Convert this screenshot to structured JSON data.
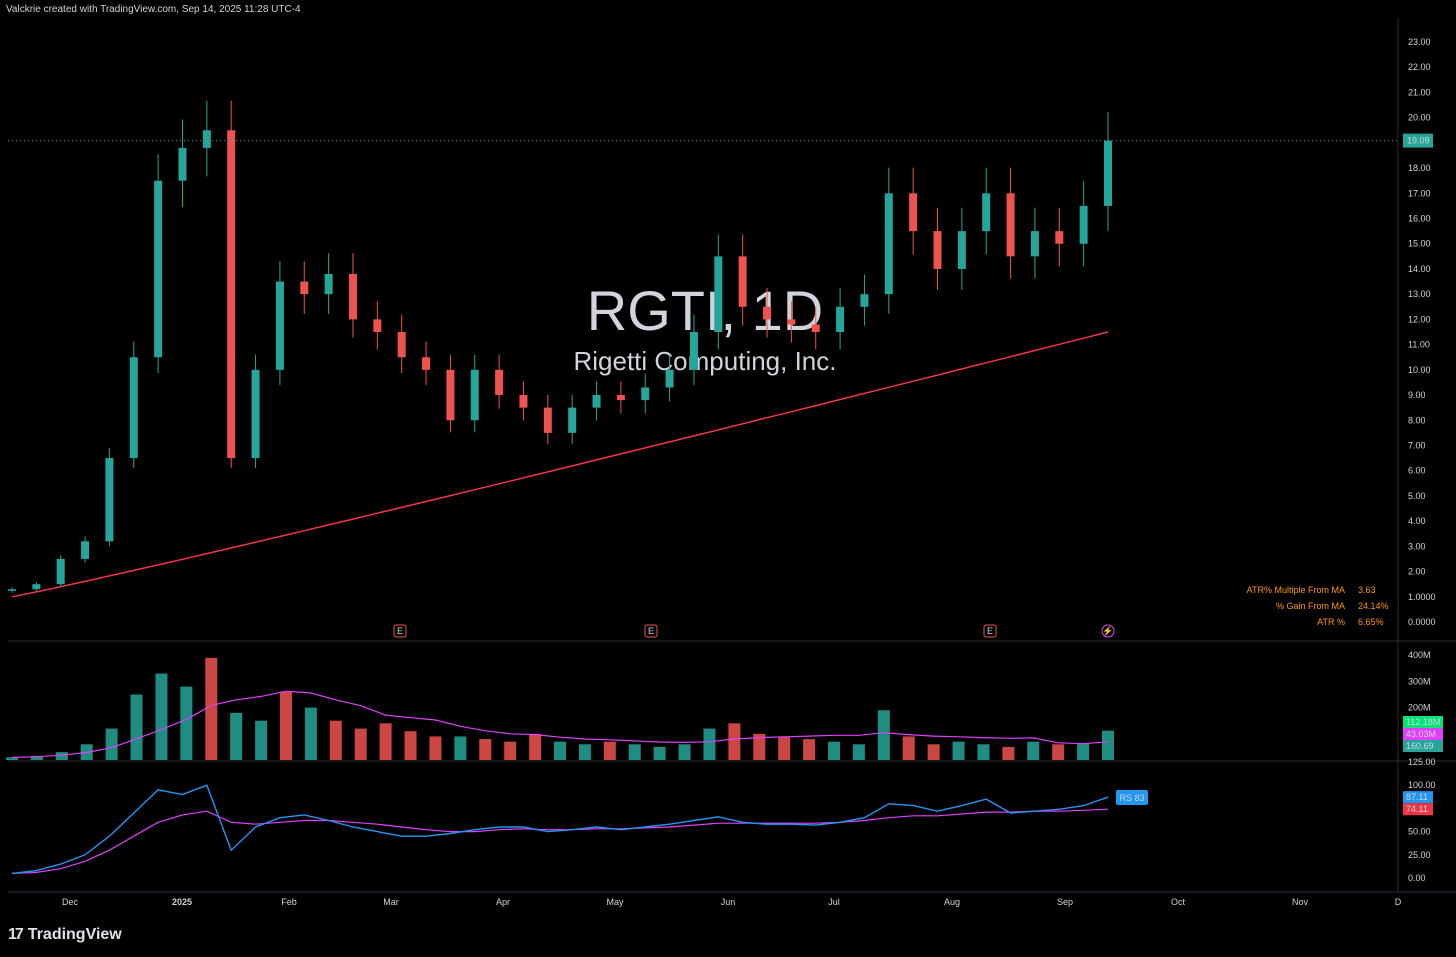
{
  "header": {
    "attribution": "Valckrie created with TradingView.com, Sep 14, 2025 11:28 UTC-4"
  },
  "brand": {
    "logo_glyph": "17",
    "name": "TradingView"
  },
  "watermark": {
    "symbol": "RGTI, 1D",
    "company": "Rigetti Computing, Inc."
  },
  "colors": {
    "up": "#26a69a",
    "down": "#ef5350",
    "bright_up": "#00e676",
    "ma200": "#f23645",
    "volume_ma": "#e040fb",
    "rs_line": "#2196f3",
    "rs_ma": "#f23645"
  },
  "chart_data": [
    {
      "type": "line",
      "name_hint": "price",
      "x": [
        "2024-11-18",
        "2024-11-25",
        "2024-12-02",
        "2024-12-09",
        "2024-12-16",
        "2024-12-23",
        "2024-12-27",
        "2025-01-02",
        "2025-01-06",
        "2025-01-08",
        "2025-01-13",
        "2025-01-21",
        "2025-01-27",
        "2025-02-03",
        "2025-02-10",
        "2025-02-18",
        "2025-02-24",
        "2025-03-03",
        "2025-03-10",
        "2025-03-17",
        "2025-03-24",
        "2025-03-31",
        "2025-04-07",
        "2025-04-14",
        "2025-04-21",
        "2025-04-28",
        "2025-05-05",
        "2025-05-12",
        "2025-05-19",
        "2025-05-27",
        "2025-06-02",
        "2025-06-09",
        "2025-06-16",
        "2025-06-23",
        "2025-06-30",
        "2025-07-07",
        "2025-07-14",
        "2025-07-21",
        "2025-07-28",
        "2025-08-04",
        "2025-08-11",
        "2025-08-18",
        "2025-08-25",
        "2025-09-02",
        "2025-09-08",
        "2025-09-12"
      ],
      "close": [
        1.3,
        1.5,
        2.5,
        3.2,
        6.5,
        10.5,
        17.5,
        18.8,
        19.5,
        6.5,
        10.0,
        13.5,
        13.0,
        13.8,
        12.0,
        11.5,
        10.5,
        10.0,
        8.0,
        10.0,
        9.0,
        8.5,
        7.5,
        8.5,
        9.0,
        8.8,
        9.3,
        10.0,
        11.5,
        14.5,
        12.5,
        12.0,
        11.8,
        11.5,
        12.5,
        13.0,
        17.0,
        15.5,
        14.0,
        15.5,
        17.0,
        14.5,
        15.5,
        15.0,
        16.5,
        19.09
      ],
      "ylim": [
        0,
        23
      ],
      "y_ticks": [
        "23.00",
        "22.00",
        "21.00",
        "20.00",
        "19.00",
        "18.00",
        "17.00",
        "16.00",
        "15.00",
        "14.00",
        "13.00",
        "12.00",
        "11.00",
        "10.00",
        "9.00",
        "8.00",
        "7.00",
        "6.00",
        "5.00",
        "4.00",
        "3.00",
        "2.00",
        "1.0000",
        "0.0000"
      ],
      "last_price_label": "19.09"
    },
    {
      "type": "bar",
      "name_hint": "volume",
      "y_ticks": [
        "400M",
        "300M",
        "200M",
        "100M"
      ],
      "labels": [
        "112.18M",
        "43.03M",
        "160.69"
      ],
      "values_M": [
        10,
        15,
        30,
        60,
        120,
        250,
        330,
        280,
        390,
        180,
        150,
        260,
        200,
        150,
        120,
        140,
        110,
        90,
        90,
        80,
        70,
        100,
        70,
        60,
        70,
        60,
        50,
        60,
        120,
        140,
        100,
        90,
        80,
        70,
        60,
        190,
        90,
        60,
        70,
        60,
        50,
        70,
        60,
        65,
        112
      ]
    },
    {
      "type": "line",
      "name_hint": "relative_strength",
      "y_ticks": [
        "125.00",
        "100.00",
        "75.00",
        "50.00",
        "25.00",
        "0.00"
      ],
      "ylim": [
        0,
        125
      ],
      "rs": [
        5,
        8,
        15,
        25,
        45,
        70,
        95,
        90,
        100,
        30,
        55,
        65,
        68,
        62,
        55,
        50,
        45,
        45,
        48,
        52,
        55,
        55,
        50,
        52,
        55,
        52,
        55,
        58,
        62,
        66,
        60,
        58,
        58,
        57,
        60,
        65,
        80,
        78,
        72,
        78,
        85,
        70,
        72,
        74,
        78,
        87.11
      ],
      "rs_ma": [
        5,
        6,
        10,
        18,
        30,
        45,
        60,
        68,
        72,
        60,
        58,
        60,
        62,
        62,
        60,
        58,
        55,
        52,
        50,
        50,
        52,
        53,
        52,
        52,
        53,
        53,
        54,
        55,
        57,
        59,
        59,
        59,
        59,
        59,
        60,
        62,
        65,
        67,
        67,
        69,
        71,
        71,
        72,
        72,
        73,
        74.11
      ],
      "labels": [
        "87.11",
        "74.11"
      ],
      "badge": "RS 83"
    }
  ],
  "stats": [
    {
      "label": "ATR% Multiple From MA",
      "value": "3.63"
    },
    {
      "label": "% Gain From MA",
      "value": "24.14%"
    },
    {
      "label": "ATR %",
      "value": "6.65%"
    }
  ],
  "x_axis": {
    "labels": [
      "Dec",
      "2025",
      "Feb",
      "Mar",
      "Apr",
      "May",
      "Jun",
      "Jul",
      "Aug",
      "Sep",
      "Oct",
      "Nov",
      "D"
    ]
  },
  "earnings_icon": "E",
  "dividend_icon": "⚡"
}
